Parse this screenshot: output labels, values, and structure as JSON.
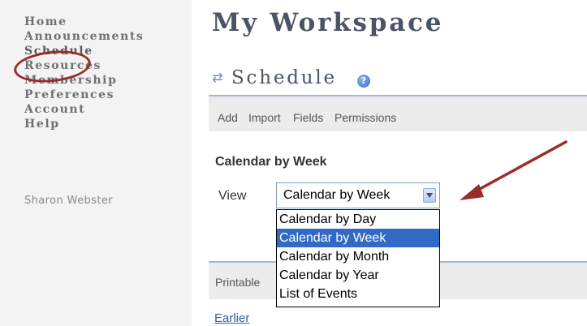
{
  "sidebar": {
    "items": [
      {
        "label": "Home"
      },
      {
        "label": "Announcements"
      },
      {
        "label": "Schedule",
        "active": true
      },
      {
        "label": "Resources"
      },
      {
        "label": "Membership"
      },
      {
        "label": "Preferences"
      },
      {
        "label": "Account"
      },
      {
        "label": "Help"
      }
    ],
    "user_name": "Sharon Webster"
  },
  "workspace_title": "My Workspace",
  "tool": {
    "icon": "refresh-arrows-icon",
    "title": "Schedule",
    "help_icon": "help-icon"
  },
  "toolbar": {
    "add": "Add",
    "import": "Import",
    "fields": "Fields",
    "permissions": "Permissions"
  },
  "section_title": "Calendar by Week",
  "view": {
    "label": "View",
    "selected": "Calendar by Week",
    "options": [
      "Calendar by Day",
      "Calendar by Week",
      "Calendar by Month",
      "Calendar by Year",
      "List of Events"
    ],
    "highlighted_index": 1
  },
  "printable_label": "Printable",
  "earlier_link": "Earlier",
  "colors": {
    "accent": "#4a5466",
    "annotation": "#9b2c2c",
    "selection": "#316ac5"
  }
}
